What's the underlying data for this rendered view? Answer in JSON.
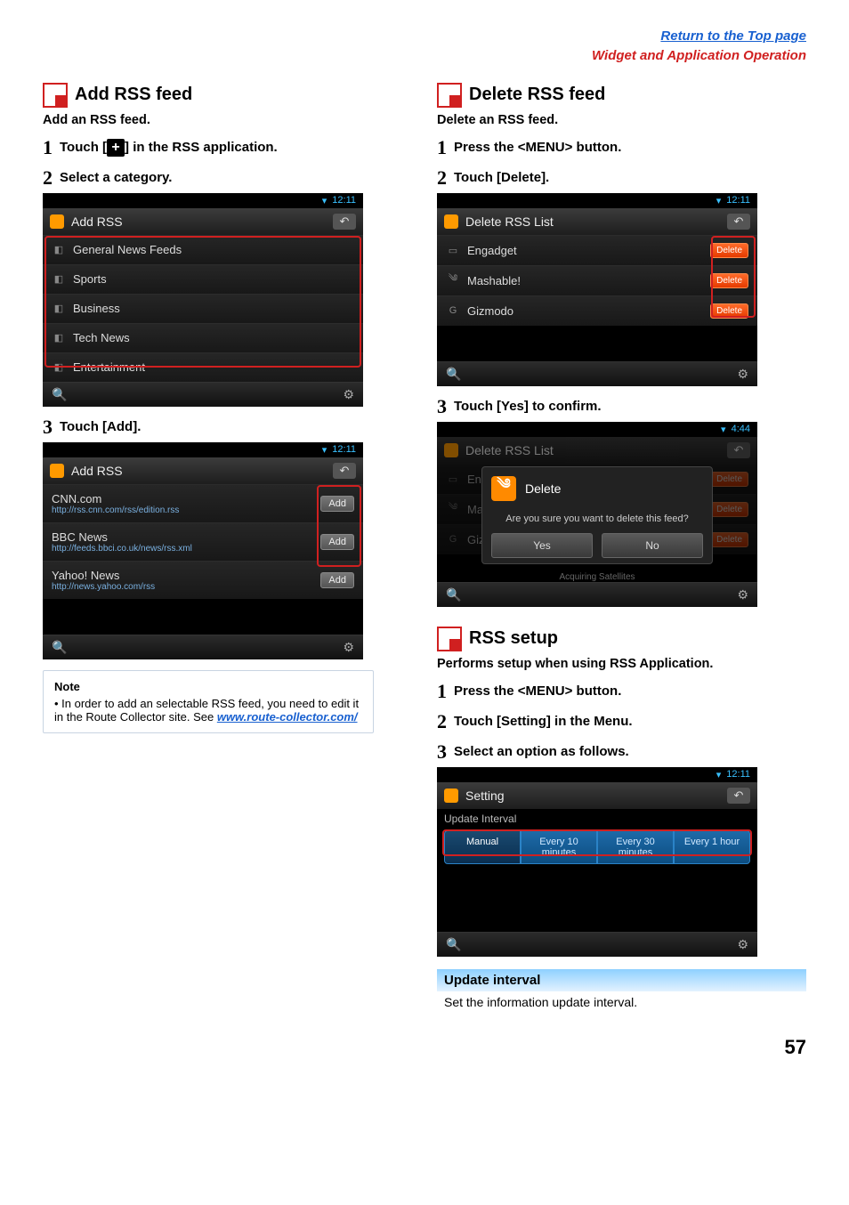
{
  "header": {
    "top_link": "Return to the Top page",
    "section_link": "Widget and Application Operation"
  },
  "left": {
    "section_title": "Add RSS feed",
    "desc": "Add an RSS feed.",
    "step1_prefix": "Touch [",
    "step1_suffix": "] in the RSS application.",
    "step2": "Select a category.",
    "step3": "Touch [Add].",
    "device1": {
      "time": "12:11",
      "title": "Add RSS",
      "rows": [
        {
          "label": "General News Feeds"
        },
        {
          "label": "Sports"
        },
        {
          "label": "Business"
        },
        {
          "label": "Tech News"
        },
        {
          "label": "Entertainment"
        }
      ]
    },
    "device2": {
      "time": "12:11",
      "title": "Add RSS",
      "add_label": "Add",
      "rows": [
        {
          "label": "CNN.com",
          "sub": "http://rss.cnn.com/rss/edition.rss"
        },
        {
          "label": "BBC News",
          "sub": "http://feeds.bbci.co.uk/news/rss.xml"
        },
        {
          "label": "Yahoo! News",
          "sub": "http://news.yahoo.com/rss"
        }
      ]
    },
    "note": {
      "title": "Note",
      "body_pre": "In order to add an selectable RSS feed, you need to edit it in the Route Collector site. See ",
      "link": "www.route-collector.com/"
    }
  },
  "right": {
    "section_title_del": "Delete RSS feed",
    "desc_del": "Delete an RSS feed.",
    "step1_del": "Press the <MENU> button.",
    "step2_del": "Touch [Delete].",
    "step3_del": "Touch [Yes] to confirm.",
    "device1": {
      "time": "12:11",
      "title": "Delete RSS List",
      "del_label": "Delete",
      "rows": [
        {
          "label": "Engadget"
        },
        {
          "label": "Mashable!"
        },
        {
          "label": "Gizmodo"
        }
      ]
    },
    "device2": {
      "time": "4:44",
      "title": "Delete RSS List",
      "dialog_title": "Delete",
      "dialog_msg": "Are you sure you want to delete this feed?",
      "yes": "Yes",
      "no": "No",
      "acq": "Acquiring Satellites",
      "dim_rows": [
        "Enga",
        "Mas",
        "Gizn"
      ]
    },
    "section_title_setup": "RSS setup",
    "desc_setup": "Performs setup when using RSS Application.",
    "step1_setup": "Press the <MENU> button.",
    "step2_setup": "Touch [Setting] in the Menu.",
    "step3_setup": "Select an option as follows.",
    "device3": {
      "time": "12:11",
      "title": "Setting",
      "seg_label": "Update Interval",
      "segs": [
        "Manual",
        "Every 10 minutes",
        "Every 30 minutes",
        "Every 1 hour"
      ]
    },
    "sub_head": "Update interval",
    "sub_text": "Set the information update interval."
  },
  "page_num": "57"
}
